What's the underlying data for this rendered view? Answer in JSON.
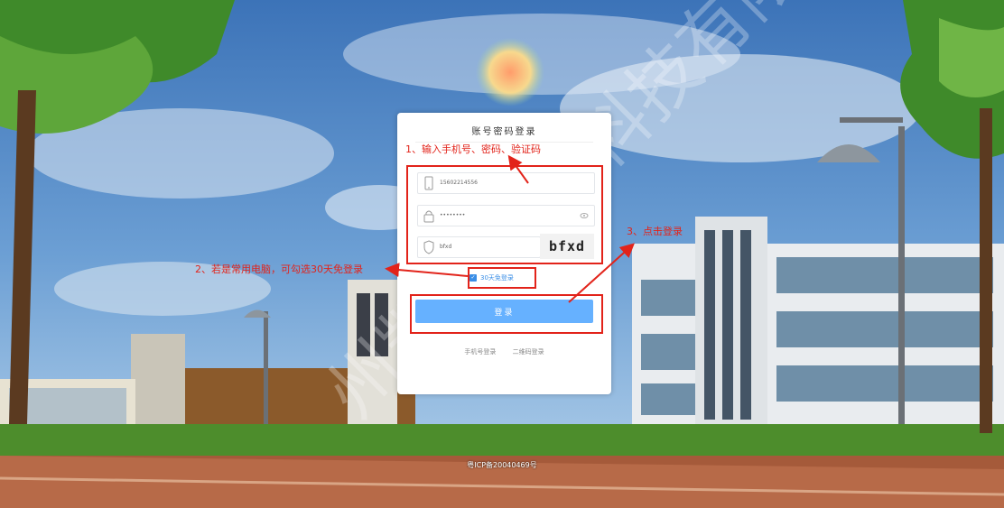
{
  "login": {
    "title": "账号密码登录",
    "phone_value": "15602214556",
    "password_value": "••••••••",
    "captcha_value": "bfxd",
    "captcha_image_text": "bfxd",
    "remember_label": "30天免登录",
    "login_button": "登录",
    "alt_phone_login": "手机号登录",
    "alt_qr_login": "二维码登录"
  },
  "annotations": {
    "step1": "1、输入手机号、密码、验证码",
    "step2": "2、若是常用电脑，可勾选30天免登录",
    "step3": "3、点击登录"
  },
  "footer": {
    "icp": "粤ICP备20040469号"
  },
  "watermark": "州凯盟软件科技有限",
  "colors": {
    "accent": "#66b1ff",
    "annotation": "#e2231a",
    "sky": "#4f86c6",
    "grass": "#4d8d2c"
  },
  "icons": [
    "phone-icon",
    "lock-icon",
    "eye-icon",
    "shield-icon",
    "checkbox-checked-icon"
  ]
}
